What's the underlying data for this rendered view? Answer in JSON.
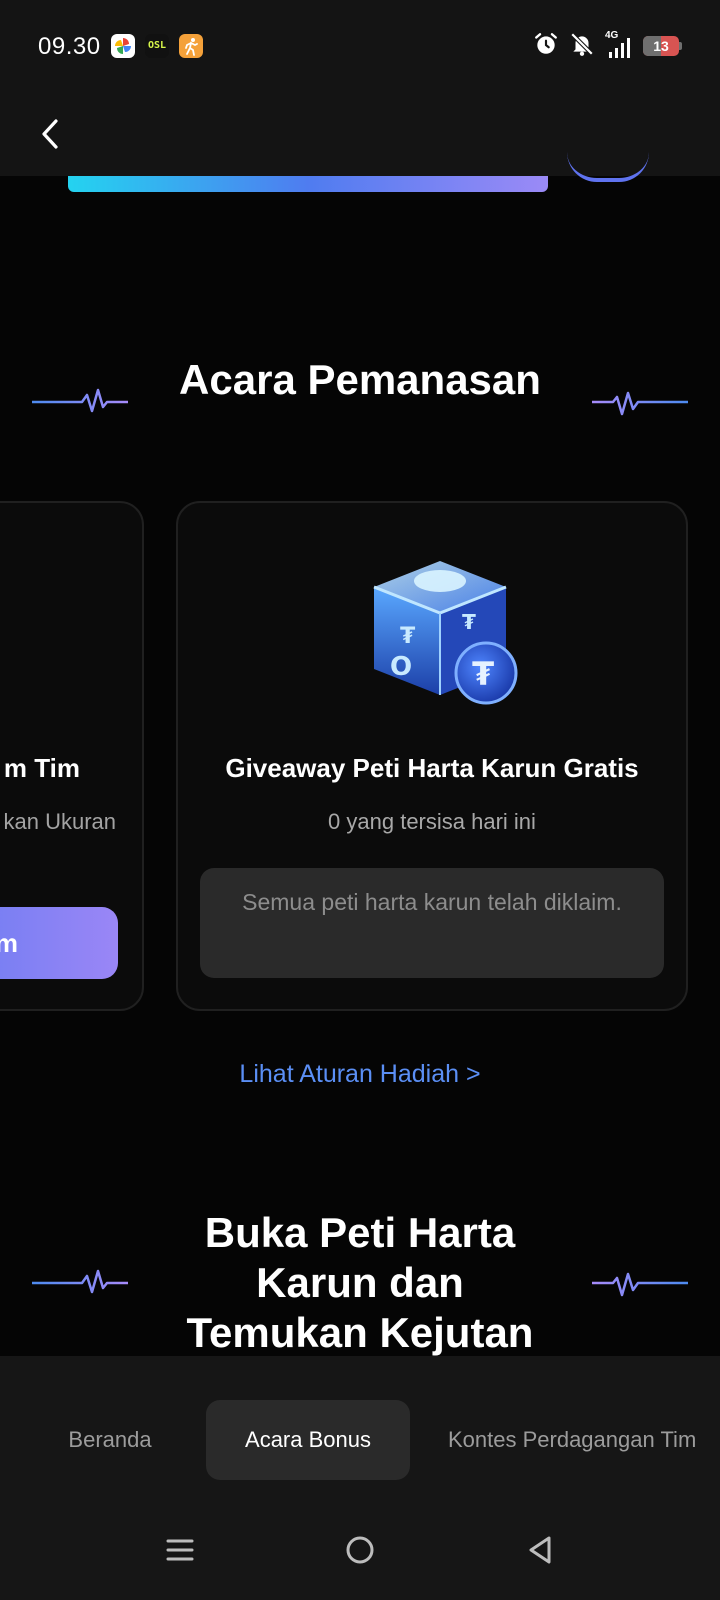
{
  "status_bar": {
    "time": "09.30",
    "osl_icon_text": "OSL",
    "network": "4G",
    "battery_percent": "13",
    "icons": [
      "photos-icon",
      "osl-app-icon",
      "running-app-icon",
      "alarm-icon",
      "notifications-muted-icon",
      "signal-icon",
      "battery-icon"
    ]
  },
  "header": {
    "back_icon": "back-arrow-icon"
  },
  "sections": {
    "warmup_title": "Acara Pemanasan",
    "chest_title": "Buka Peti Harta Karun dan Temukan Kejutan"
  },
  "cards": {
    "left_partial": {
      "title": "m Tim",
      "subtitle": "kan Ukuran",
      "button_label": "Tim"
    },
    "main": {
      "image": "treasure-chest-icon",
      "title": "Giveaway Peti Harta Karun Gratis",
      "subtitle": "0 yang tersisa hari ini",
      "status_message": "Semua peti harta karun telah diklaim."
    }
  },
  "rules_link": "Lihat Aturan Hadiah >",
  "tabs": {
    "home": "Beranda",
    "bonus": "Acara Bonus",
    "contest": "Kontes Perdagangan Tim",
    "active": "bonus"
  },
  "colors": {
    "background": "#050505",
    "card_border": "#202020",
    "accent_blue": "#5b8ff5",
    "gradient_start": "#5d79f0",
    "gradient_end": "#9a86f6",
    "battery_low": "#d85452"
  }
}
